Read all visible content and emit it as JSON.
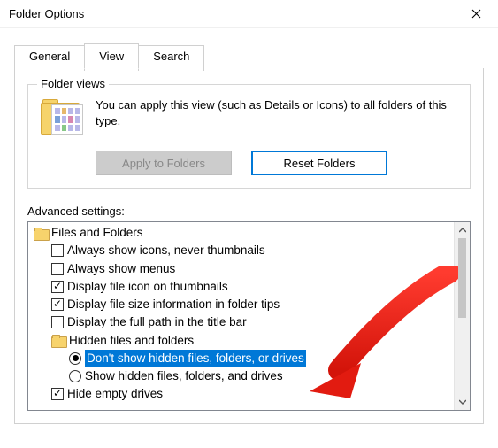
{
  "window": {
    "title": "Folder Options"
  },
  "tabs": {
    "general": "General",
    "view": "View",
    "search": "Search"
  },
  "folder_views": {
    "group_label": "Folder views",
    "description": "You can apply this view (such as Details or Icons) to all folders of this type.",
    "apply_label": "Apply to Folders",
    "reset_label": "Reset Folders"
  },
  "advanced": {
    "label": "Advanced settings:",
    "root": "Files and Folders",
    "items": [
      {
        "label": "Always show icons, never thumbnails",
        "checked": false
      },
      {
        "label": "Always show menus",
        "checked": false
      },
      {
        "label": "Display file icon on thumbnails",
        "checked": true
      },
      {
        "label": "Display file size information in folder tips",
        "checked": true
      },
      {
        "label": "Display the full path in the title bar",
        "checked": false
      }
    ],
    "hidden_group": "Hidden files and folders",
    "hidden_options": [
      {
        "label": "Don't show hidden files, folders, or drives",
        "selected": true
      },
      {
        "label": "Show hidden files, folders, and drives",
        "selected": false
      }
    ],
    "tail": [
      {
        "label": "Hide empty drives",
        "checked": true
      }
    ]
  }
}
